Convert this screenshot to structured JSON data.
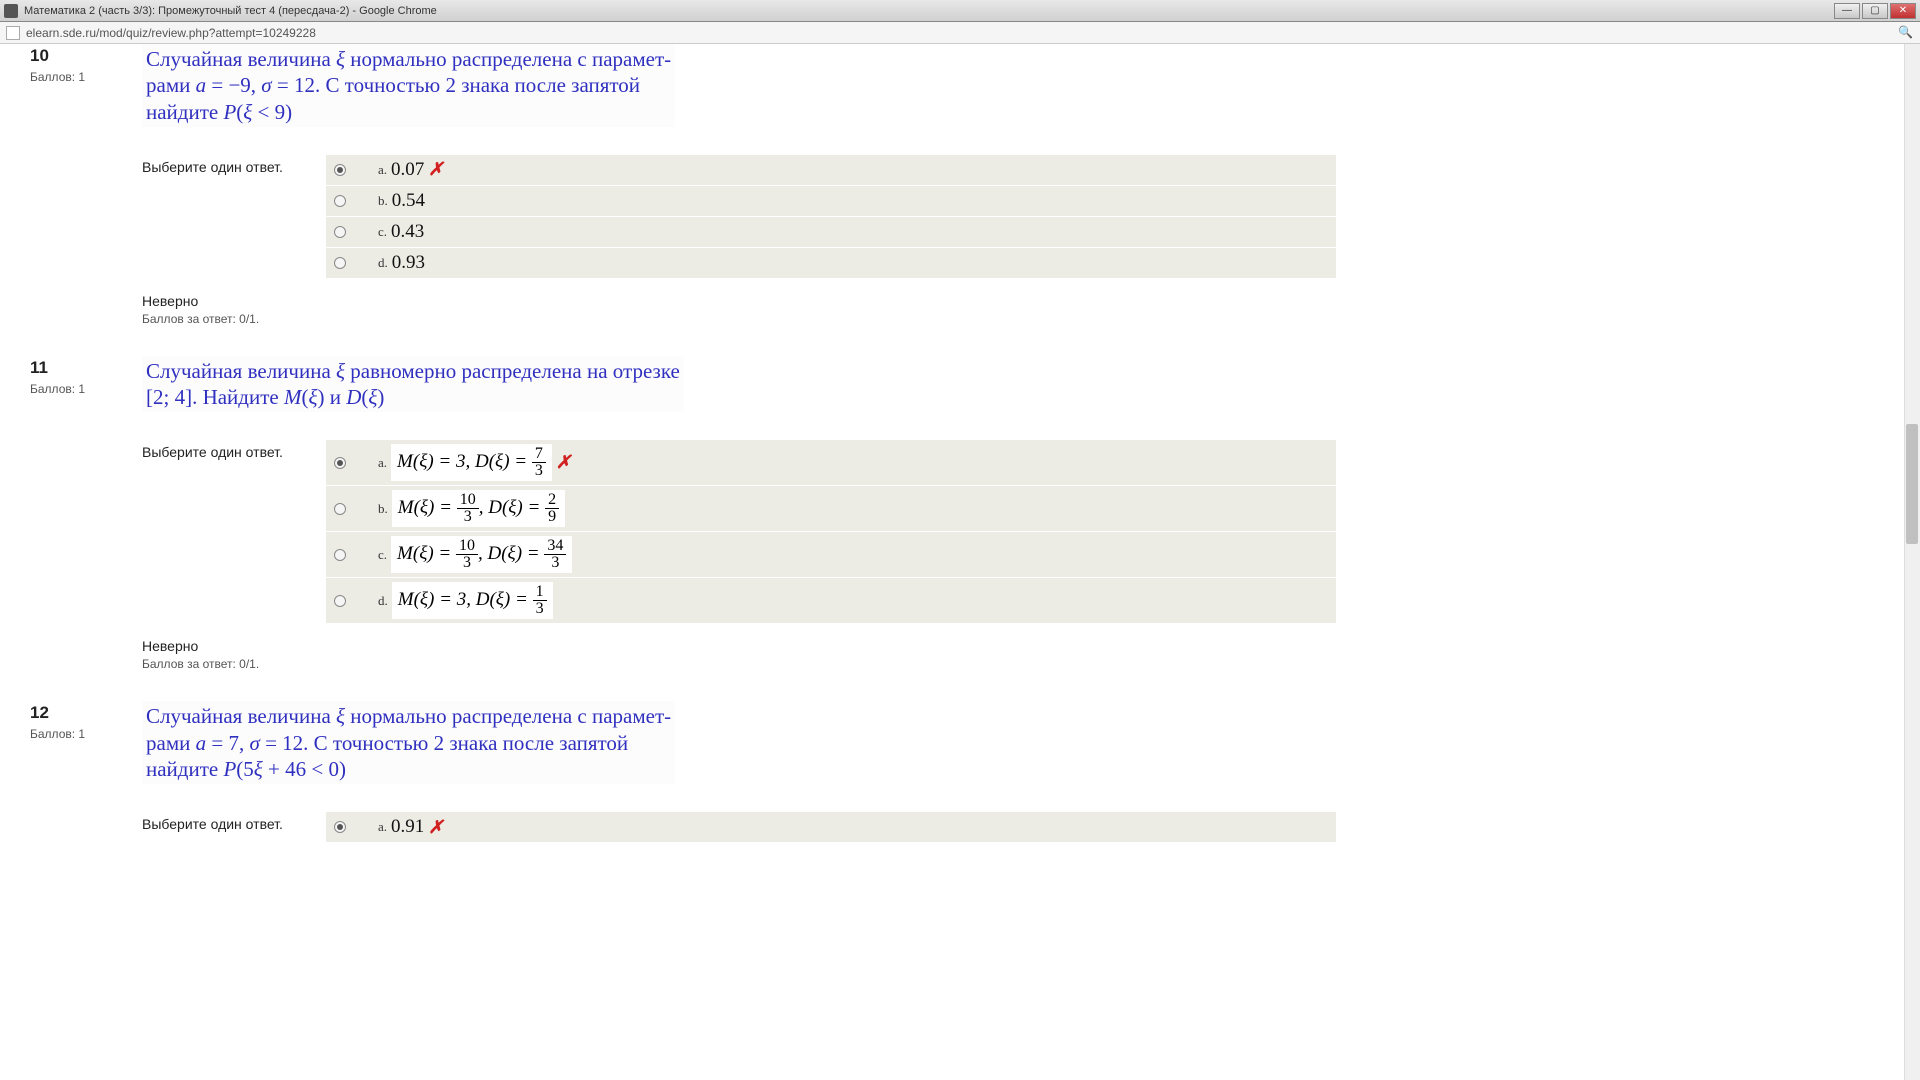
{
  "window": {
    "title": "Математика 2 (часть 3/3): Промежуточный тест 4 (пересдача-2) - Google Chrome"
  },
  "address": "elearn.sde.ru/mod/quiz/review.php?attempt=10249228",
  "labels": {
    "points_prefix": "Баллов: ",
    "choose": "Выберите один ответ.",
    "wrong": "Неверно",
    "score_prefix": "Баллов за ответ: "
  },
  "questions": [
    {
      "num": "10",
      "points": "1",
      "text_html": "Случайная величина <i>ξ</i> нормально распределена с парамет-<br>рами <i>a</i> = −9, <i>σ</i> = 12. С точностью 2 знака после запятой<br>найдите <i>P</i>(<i>ξ</i> < 9)",
      "answers": [
        {
          "letter": "a.",
          "value": "0.07",
          "selected": true,
          "wrong": true
        },
        {
          "letter": "b.",
          "value": "0.54",
          "selected": false
        },
        {
          "letter": "c.",
          "value": "0.43",
          "selected": false
        },
        {
          "letter": "d.",
          "value": "0.93",
          "selected": false
        }
      ],
      "feedback": "Неверно",
      "score": "0/1."
    },
    {
      "num": "11",
      "points": "1",
      "text_html": "Случайная величина <i>ξ</i> равномерно распределена на отрезке<br>[2; 4]. Найдите <i>M</i>(<i>ξ</i>) и <i>D</i>(<i>ξ</i>)",
      "answers": [
        {
          "letter": "a.",
          "formula": {
            "m_num": "",
            "m_den": "",
            "m_val": "3",
            "d_num": "7",
            "d_den": "3"
          },
          "selected": true,
          "wrong": true
        },
        {
          "letter": "b.",
          "formula": {
            "m_num": "10",
            "m_den": "3",
            "d_num": "2",
            "d_den": "9"
          },
          "selected": false
        },
        {
          "letter": "c.",
          "formula": {
            "m_num": "10",
            "m_den": "3",
            "d_num": "34",
            "d_den": "3"
          },
          "selected": false
        },
        {
          "letter": "d.",
          "formula": {
            "m_num": "",
            "m_den": "",
            "m_val": "3",
            "d_num": "1",
            "d_den": "3"
          },
          "selected": false
        }
      ],
      "feedback": "Неверно",
      "score": "0/1."
    },
    {
      "num": "12",
      "points": "1",
      "text_html": "Случайная величина <i>ξ</i> нормально распределена с парамет-<br>рами <i>a</i> = 7, <i>σ</i> = 12. С точностью 2 знака после запятой<br>найдите <i>P</i>(5<i>ξ</i> + 46 < 0)",
      "answers": [
        {
          "letter": "a.",
          "value": "0.91",
          "selected": true,
          "wrong": true
        }
      ],
      "partial": true
    }
  ]
}
